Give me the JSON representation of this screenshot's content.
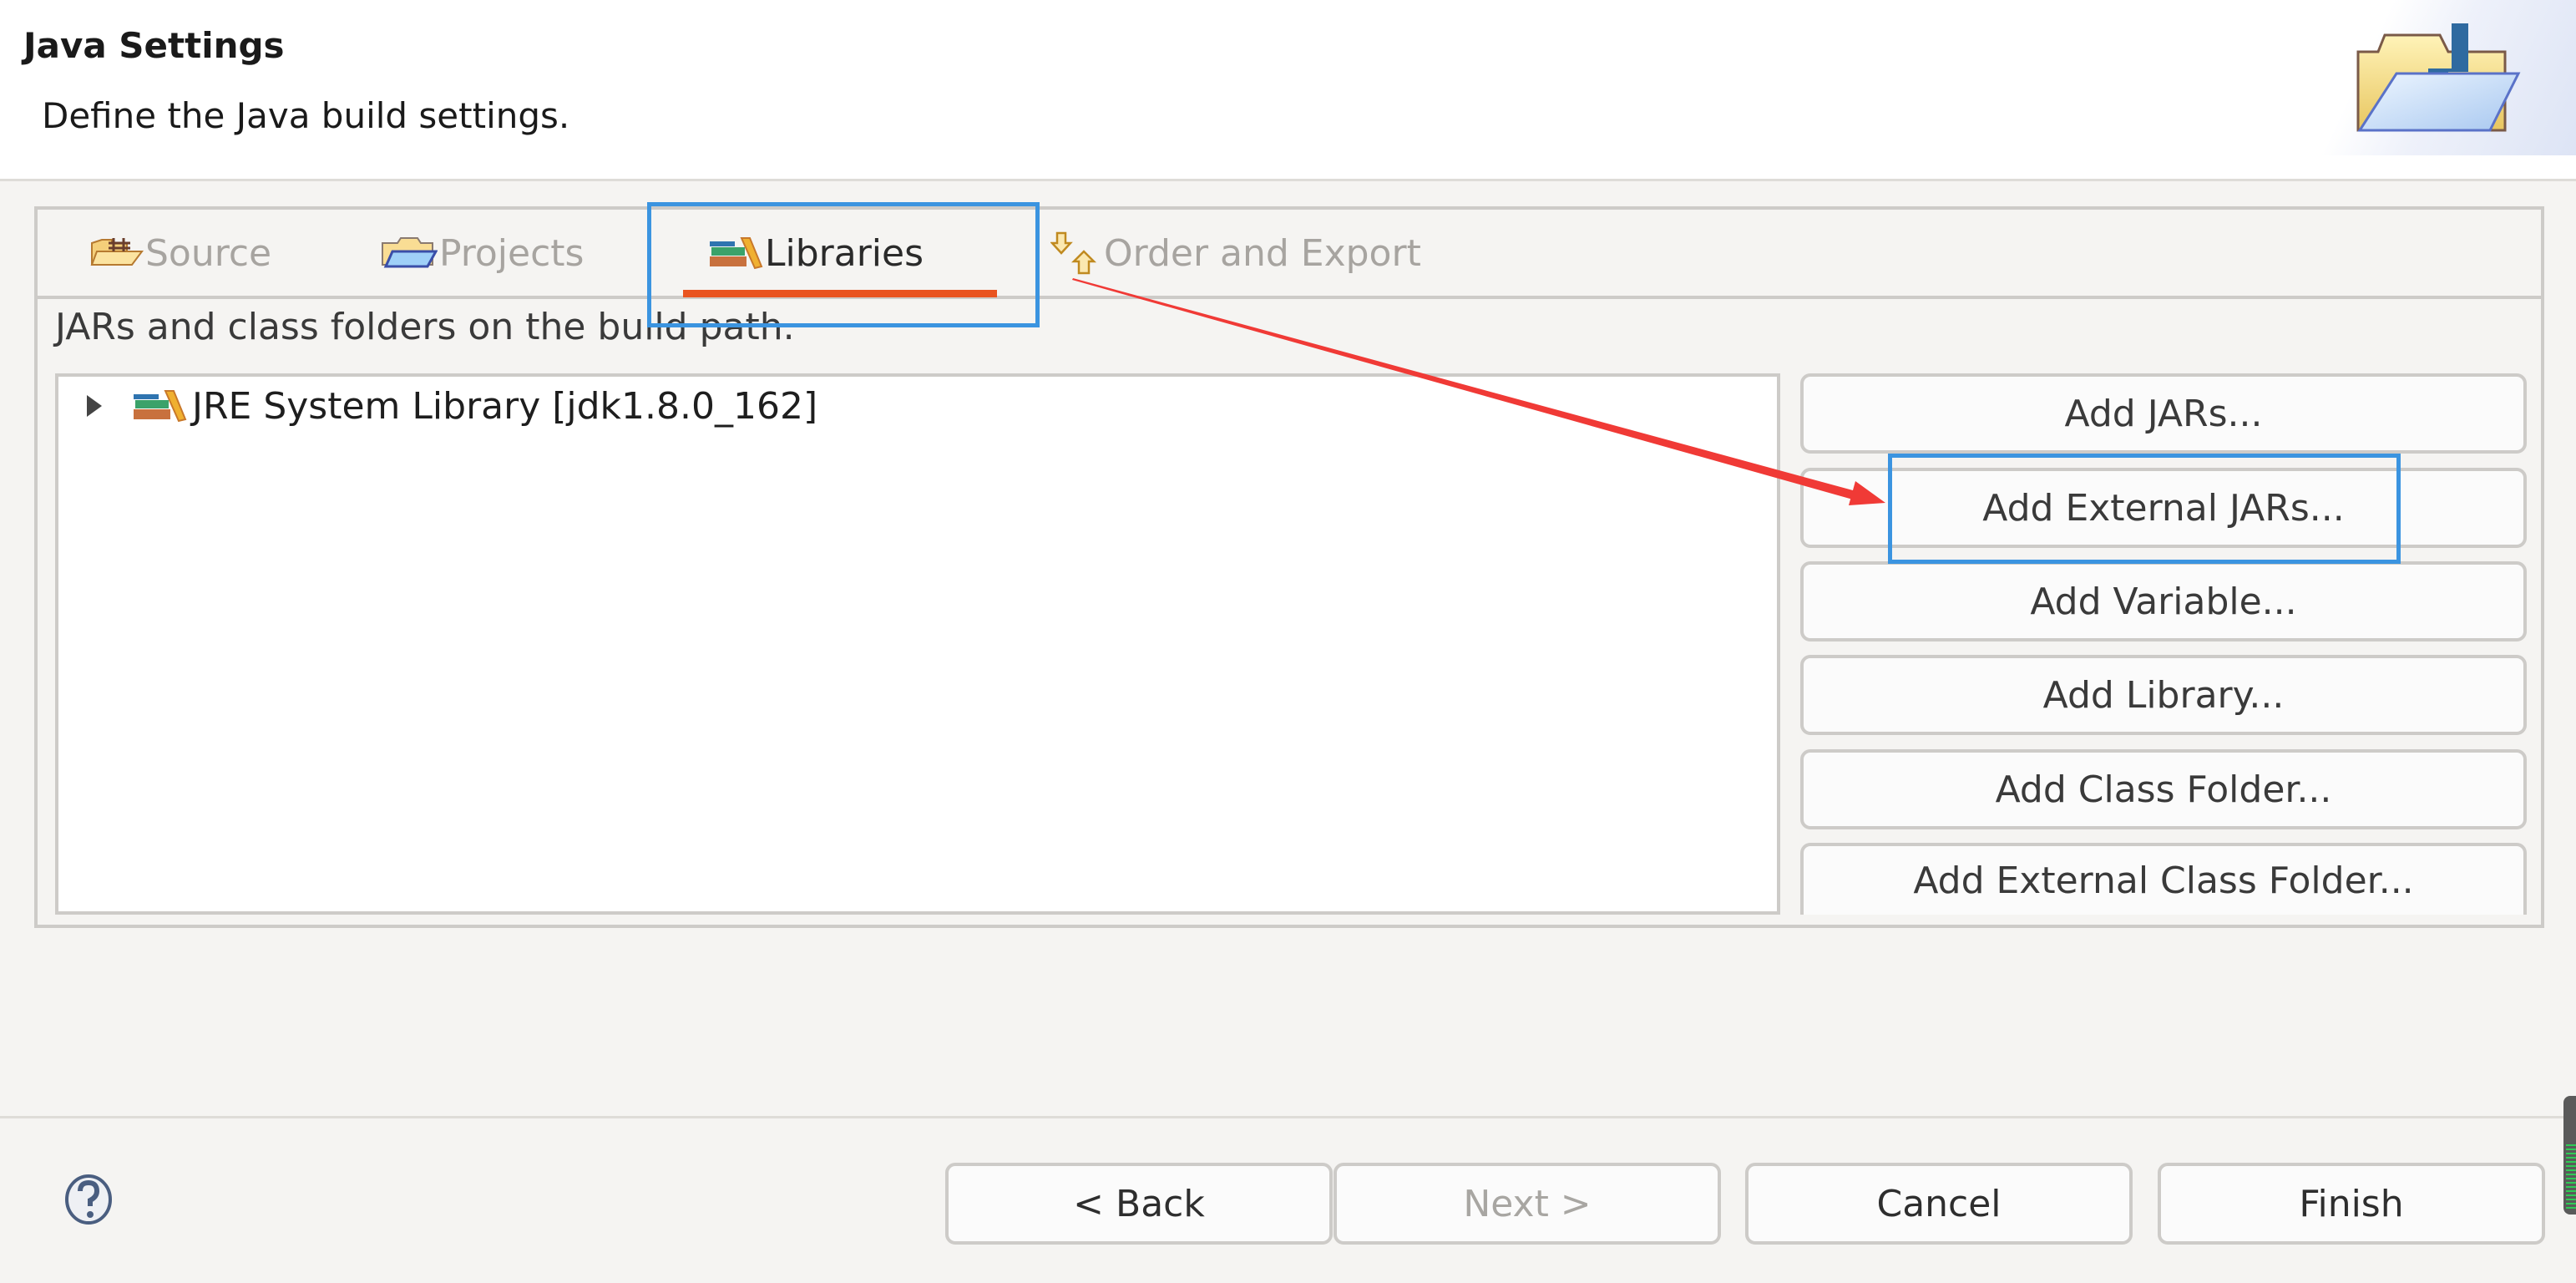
{
  "header": {
    "title": "Java Settings",
    "subtitle": "Define the Java build settings.",
    "banner_icon": "java-folder-wizard-icon"
  },
  "tabs": [
    {
      "label": "Source",
      "icon": "source-folder-icon",
      "active": false
    },
    {
      "label": "Projects",
      "icon": "projects-folder-icon",
      "active": false
    },
    {
      "label": "Libraries",
      "icon": "libraries-icon",
      "active": true
    },
    {
      "label": "Order and Export",
      "icon": "order-export-icon",
      "active": false
    }
  ],
  "libraries": {
    "description": "JARs and class folders on the build path.",
    "tree_items": [
      {
        "label": "JRE System Library [jdk1.8.0_162]",
        "icon": "library-icon",
        "expanded": false
      }
    ],
    "buttons": [
      "Add JARs...",
      "Add External JARs...",
      "Add Variable...",
      "Add Library...",
      "Add Class Folder...",
      "Add External Class Folder..."
    ]
  },
  "footer": {
    "help_icon": "help-icon",
    "back_label": "< Back",
    "next_label": "Next >",
    "next_enabled": false,
    "cancel_label": "Cancel",
    "finish_label": "Finish"
  },
  "annotations": {
    "highlighted": [
      "Libraries",
      "Add External JARs..."
    ],
    "box_color": "#3b94e0",
    "arrow_color": "#f03a36"
  },
  "colors": {
    "tab_active_underline": "#e95420",
    "background": "#f5f4f2"
  }
}
